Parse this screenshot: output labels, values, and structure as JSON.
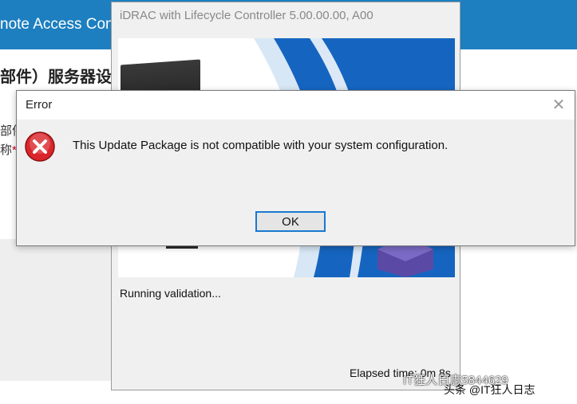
{
  "background": {
    "header_title": "note Access Con",
    "page_title": "部件）服务器设",
    "label_1": "部件",
    "label_2": "称",
    "required_mark": "*"
  },
  "installer": {
    "title": "iDRAC with Lifecycle Controller 5.00.00.00, A00",
    "status": "Running validation...",
    "elapsed": "Elapsed time: 0m 8s"
  },
  "dialog": {
    "title": "Error",
    "close_glyph": "✕",
    "message": "This Update Package is not compatible with your system configuration.",
    "ok_label": "OK",
    "icon": "error-icon"
  },
  "watermark": {
    "line1": "IT狂人日志5844629",
    "line2": "头条 @IT狂人日志"
  },
  "colors": {
    "header_blue": "#1d7fc0",
    "banner_blue": "#1565c0",
    "error_red": "#d9262c",
    "ok_border": "#1979d1"
  }
}
